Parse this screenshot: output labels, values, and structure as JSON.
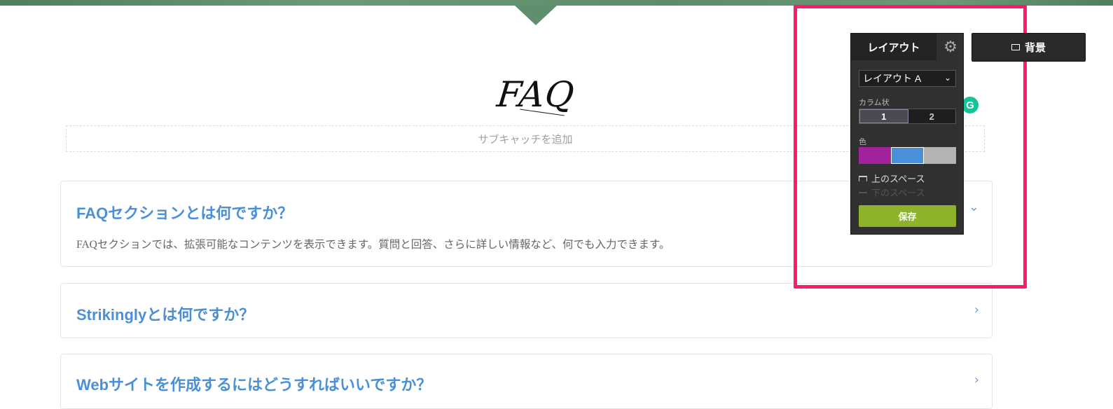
{
  "section": {
    "title": "FAQ",
    "subtitle_placeholder": "サブキャッチを追加"
  },
  "faq_items": [
    {
      "question": "FAQセクションとは何ですか？",
      "answer": "FAQセクションでは、拡張可能なコンテンツを表示できます。質問と回答、さらに詳しい情報など、何でも入力できます。",
      "expanded": true
    },
    {
      "question": "Strikinglyとは何ですか？",
      "expanded": false
    },
    {
      "question": "Webサイトを作成するにはどうすればいいですか？",
      "expanded": false
    }
  ],
  "grammarly_label": "G",
  "layout_panel": {
    "tab_label": "レイアウト",
    "selected_layout": "レイアウト A",
    "columns_label": "カラム状",
    "column_options": [
      "1",
      "2"
    ],
    "selected_column": "1",
    "color_label": "色",
    "colors": [
      "#a2229e",
      "#4a90d9",
      "#b3b3b3"
    ],
    "selected_color": "#4a90d9",
    "top_space_label": "上のスペース",
    "bottom_space_label": "下のスペース",
    "save_label": "保存"
  },
  "background_button": {
    "label": "背景"
  },
  "highlight_color": "#ff1a66"
}
